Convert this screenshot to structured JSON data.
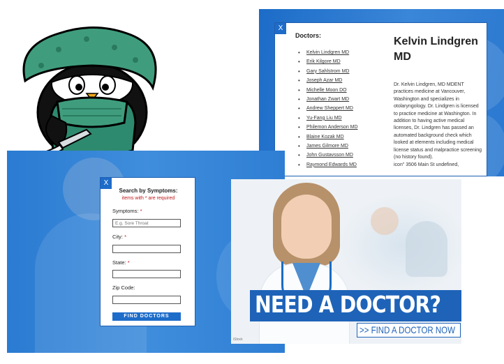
{
  "doctors_panel": {
    "close": "X",
    "list_title": "Doctors:",
    "doctors": [
      "Kelvin Lindgren MD",
      "Erik Kilgore MD",
      "Gary Sahlstrom MD",
      "Joseph Azar MD",
      "Michelle Moon DO",
      "Jonathan Zwart MD",
      "Andrew Sheppert MD",
      "Yu-Fang Liu MD",
      "Philemon Anderson MD",
      "Blaine Kozak MD",
      "James Gilmore MD",
      "John Gustavsson MD",
      "Raymond Edwards MD"
    ],
    "selected_name": "Kelvin Lindgren MD",
    "bio": "Dr. Kelvin Lindgren, MD MDENT practices medicine at Vancouver, Washington and specializes in otolaryngology. Dr. Lindgren is licensed to practice medicine at Washington. In addition to having active medical licenses, Dr. Lindgren has passed an automated background check which looked at elements including medical license status and malpractice screening (no history found).",
    "address": "icon\" 3506 Main St undefined,"
  },
  "symptoms_form": {
    "close": "X",
    "title": "Search by Symptoms:",
    "required_note": "items with * are required",
    "fields": [
      {
        "label": "Symptoms:",
        "required": true,
        "placeholder": "E.g. Sore Throat",
        "value": ""
      },
      {
        "label": "City:",
        "required": true,
        "placeholder": "",
        "value": ""
      },
      {
        "label": "State:",
        "required": true,
        "placeholder": "",
        "value": ""
      },
      {
        "label": "Zip Code:",
        "required": false,
        "placeholder": "",
        "value": ""
      }
    ],
    "submit_label": "FIND DOCTORS"
  },
  "banner": {
    "headline": "NEED A DOCTOR?",
    "cta": ">> FIND A DOCTOR NOW",
    "credit": "iStock"
  },
  "colors": {
    "brand_blue": "#1e6cc9",
    "required_red": "#c0181b",
    "surgeon_green": "#2e8a6e"
  }
}
